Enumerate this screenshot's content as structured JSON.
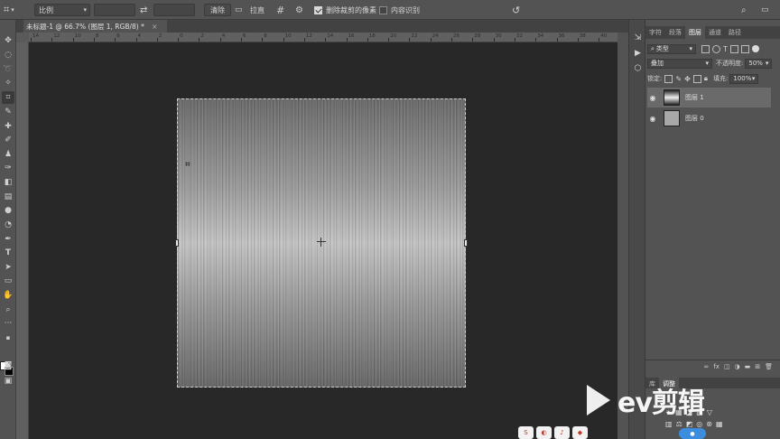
{
  "options_bar": {
    "ratio_label": "比例",
    "clear_label": "清除",
    "straighten_label": "拉直",
    "delete_cropped_label": "删除裁剪的像素",
    "content_aware_label": "内容识别"
  },
  "document": {
    "tab_title": "未标题-1 @ 66.7% (图层 1, RGB/8) *",
    "close_symbol": "×"
  },
  "ruler": {
    "ticks": [
      "14",
      "12",
      "10",
      "8",
      "6",
      "4",
      "2",
      "0",
      "2",
      "4",
      "6",
      "8",
      "10",
      "12",
      "14",
      "16",
      "18",
      "20",
      "22",
      "24",
      "26",
      "28",
      "30",
      "32",
      "34",
      "36",
      "38",
      "40"
    ]
  },
  "panel": {
    "tabs": [
      "字符",
      "段落",
      "图层",
      "通道",
      "路径"
    ],
    "active_tab": "图层",
    "kind_filter": "类型",
    "blend_mode": "叠加",
    "opacity_label": "不透明度:",
    "opacity_value": "50%",
    "lock_label": "锁定:",
    "fill_label": "填充:",
    "fill_value": "100%",
    "layers": [
      {
        "name": "图层 1",
        "selected": true
      },
      {
        "name": "图层 0",
        "selected": false
      }
    ],
    "bottom_icons": [
      "fx"
    ],
    "lower_tabs": [
      "库",
      "调整"
    ]
  },
  "watermark": {
    "text": "ev剪辑"
  },
  "icons": {
    "crop_tool": "crop-icon",
    "home": "home-icon",
    "search": "search-icon",
    "workspace": "workspace-icon"
  },
  "colors": {
    "foreground": "#ffffff",
    "background": "#000000",
    "ui_base": "#535353",
    "workspace": "#282828"
  }
}
